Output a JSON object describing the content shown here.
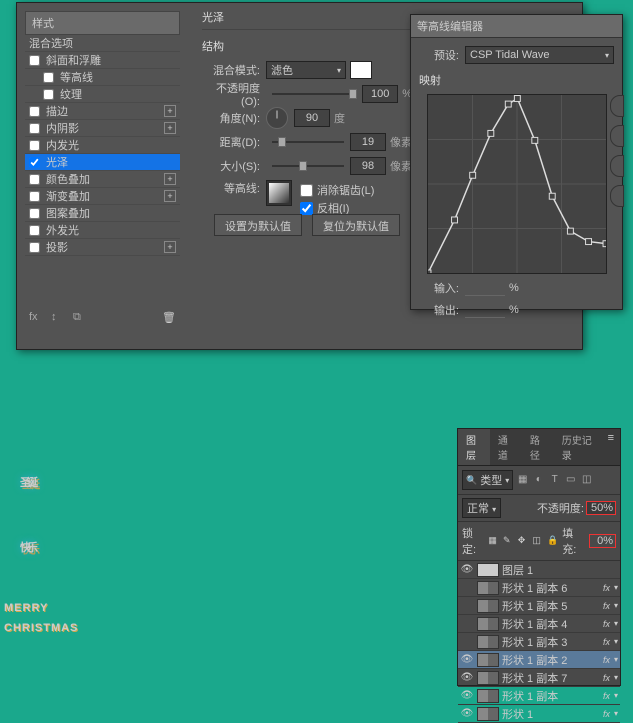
{
  "styles": {
    "header": "样式",
    "blend_options": "混合选项",
    "list": [
      {
        "label": "斜面和浮雕",
        "checked": false,
        "plus": false
      },
      {
        "label": "等高线",
        "checked": false,
        "plus": false,
        "indent": true
      },
      {
        "label": "纹理",
        "checked": false,
        "plus": false,
        "indent": true
      },
      {
        "label": "描边",
        "checked": false,
        "plus": true
      },
      {
        "label": "内阴影",
        "checked": false,
        "plus": true
      },
      {
        "label": "内发光",
        "checked": false,
        "plus": false
      },
      {
        "label": "光泽",
        "checked": true,
        "plus": false,
        "selected": true
      },
      {
        "label": "颜色叠加",
        "checked": false,
        "plus": true
      },
      {
        "label": "渐变叠加",
        "checked": false,
        "plus": true
      },
      {
        "label": "图案叠加",
        "checked": false,
        "plus": false
      },
      {
        "label": "外发光",
        "checked": false,
        "plus": false
      },
      {
        "label": "投影",
        "checked": false,
        "plus": true
      }
    ]
  },
  "satin": {
    "title": "光泽",
    "structure": "结构",
    "blend_mode_label": "混合模式:",
    "blend_mode_value": "滤色",
    "opacity_label": "不透明度(O):",
    "opacity_value": "100",
    "percent": "%",
    "angle_label": "角度(N):",
    "angle_value": "90",
    "angle_unit": "度",
    "distance_label": "距离(D):",
    "distance_value": "19",
    "px": "像素",
    "size_label": "大小(S):",
    "size_value": "98",
    "contour_label": "等高线:",
    "antialias": "消除锯齿(L)",
    "invert": "反相(I)",
    "btn_default": "设置为默认值",
    "btn_reset": "复位为默认值"
  },
  "contour_editor": {
    "title": "等高线编辑器",
    "preset_label": "预设:",
    "preset_value": "CSP Tidal Wave",
    "mapping": "映射",
    "input_label": "输入:",
    "output_label": "输出:",
    "percent": "%"
  },
  "art": {
    "main1": "圣诞",
    "main2": "快乐",
    "sub1": "MERRY",
    "sub2": "CHRISTMAS"
  },
  "layers": {
    "tabs": [
      "图层",
      "通道",
      "路径",
      "历史记录"
    ],
    "kind": "类型",
    "mode": "正常",
    "opacity_label": "不透明度:",
    "opacity_value": "50%",
    "lock_label": "锁定:",
    "fill_label": "填充:",
    "fill_value": "0%",
    "items": [
      {
        "name": "图层 1",
        "eye": true,
        "fx": false,
        "plain": true
      },
      {
        "name": "形状 1 副本 6",
        "eye": false,
        "fx": true
      },
      {
        "name": "形状 1 副本 5",
        "eye": false,
        "fx": true
      },
      {
        "name": "形状 1 副本 4",
        "eye": false,
        "fx": true
      },
      {
        "name": "形状 1 副本 3",
        "eye": false,
        "fx": true
      },
      {
        "name": "形状 1 副本 2",
        "eye": true,
        "fx": true,
        "sel": true
      },
      {
        "name": "形状 1 副本 7",
        "eye": true,
        "fx": true
      },
      {
        "name": "形状 1 副本",
        "eye": true,
        "fx": true
      },
      {
        "name": "形状 1",
        "eye": true,
        "fx": true
      }
    ]
  },
  "chart_data": {
    "type": "line",
    "title": "等高线 映射",
    "xlabel": "输入",
    "ylabel": "输出",
    "xlim": [
      0,
      255
    ],
    "ylim": [
      0,
      255
    ],
    "points": [
      {
        "x": 0,
        "y": 0
      },
      {
        "x": 38,
        "y": 76
      },
      {
        "x": 64,
        "y": 140
      },
      {
        "x": 90,
        "y": 200
      },
      {
        "x": 115,
        "y": 242
      },
      {
        "x": 128,
        "y": 250
      },
      {
        "x": 153,
        "y": 190
      },
      {
        "x": 178,
        "y": 110
      },
      {
        "x": 204,
        "y": 60
      },
      {
        "x": 230,
        "y": 45
      },
      {
        "x": 255,
        "y": 42
      }
    ]
  }
}
